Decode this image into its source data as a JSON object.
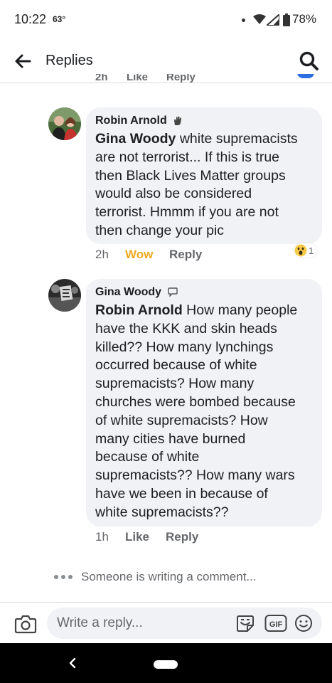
{
  "status_bar": {
    "time": "10:22",
    "temp": "63°",
    "battery": "78%"
  },
  "header": {
    "title": "Replies"
  },
  "prev_actions": {
    "time": "2h",
    "like": "Like",
    "reply": "Reply"
  },
  "comments": [
    {
      "author": "Robin Arnold",
      "mention": "Gina Woody",
      "lines": [
        " white supremacists",
        "are not terrorist... If this is true",
        "then Black Lives Matter groups",
        "would also be considered",
        "terrorist. Hmmm if you are not",
        "then change your pic"
      ],
      "time": "2h",
      "reaction_label": "Wow",
      "reply": "Reply",
      "reaction_count": "1"
    },
    {
      "author": "Gina Woody",
      "mention": "Robin Arnold",
      "lines": [
        " How many people",
        "have the KKK and skin heads",
        "killed?? How many lynchings",
        "occurred because of white",
        "supremacists? How many",
        "churches were bombed because",
        "of white supremacists? How",
        "many cities have burned",
        "because of white",
        "supremacists?? How many wars",
        "have we been in because of",
        "white supremacists??"
      ],
      "time": "1h",
      "like": "Like",
      "reply": "Reply"
    }
  ],
  "typing_text": "Someone is writing a comment...",
  "composer": {
    "placeholder": "Write a reply..."
  },
  "colors": {
    "bubble": "#f0f2f5",
    "wow": "#e9a920",
    "meta": "#65676b",
    "accent": "#1877f2"
  }
}
